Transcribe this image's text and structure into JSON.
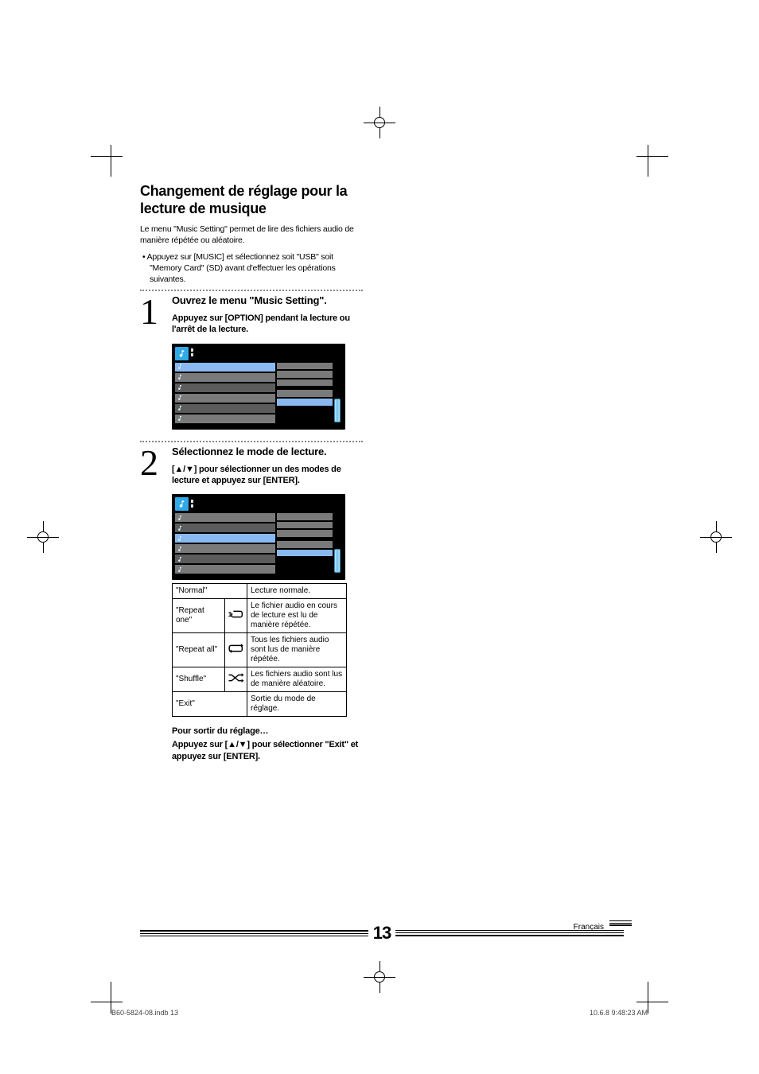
{
  "heading": "Changement de réglage pour la lecture de musique",
  "intro": "Le menu \"Music Setting\" permet de lire des fichiers audio de manière répétée ou aléatoire.",
  "bullet": "Appuyez sur [MUSIC] et sélectionnez soit \"USB\" soit \"Memory Card\" (SD) avant d'effectuer les opérations suivantes.",
  "step1": {
    "num": "1",
    "title": "Ouvrez le menu \"Music Setting\".",
    "sub": "Appuyez sur [OPTION] pendant la lecture ou l'arrêt de la lecture."
  },
  "step2": {
    "num": "2",
    "title": "Sélectionnez le mode de lecture.",
    "sub": "[▲/▼] pour sélectionner un des modes de lecture et appuyez sur [ENTER]."
  },
  "modes": [
    {
      "name": "\"Normal\"",
      "desc": "Lecture normale."
    },
    {
      "name": "\"Repeat one\"",
      "desc": "Le fichier audio en cours de lecture est lu de manière répétée."
    },
    {
      "name": "\"Repeat all\"",
      "desc": "Tous les fichiers audio sont lus de manière répétée."
    },
    {
      "name": "\"Shuffle\"",
      "desc": "Les fichiers audio sont lus de manière aléatoire."
    },
    {
      "name": "\"Exit\"",
      "desc": "Sortie du mode de réglage."
    }
  ],
  "after": {
    "title": "Pour sortir du réglage…",
    "sub": "Appuyez sur [▲/▼] pour sélectionner \"Exit\" et appuyez sur [ENTER]."
  },
  "footer": {
    "page": "13",
    "lang": "Français",
    "meta_left": "B60-5824-08.indb   13",
    "meta_right": "10.6.8   9:48:23 AM"
  }
}
